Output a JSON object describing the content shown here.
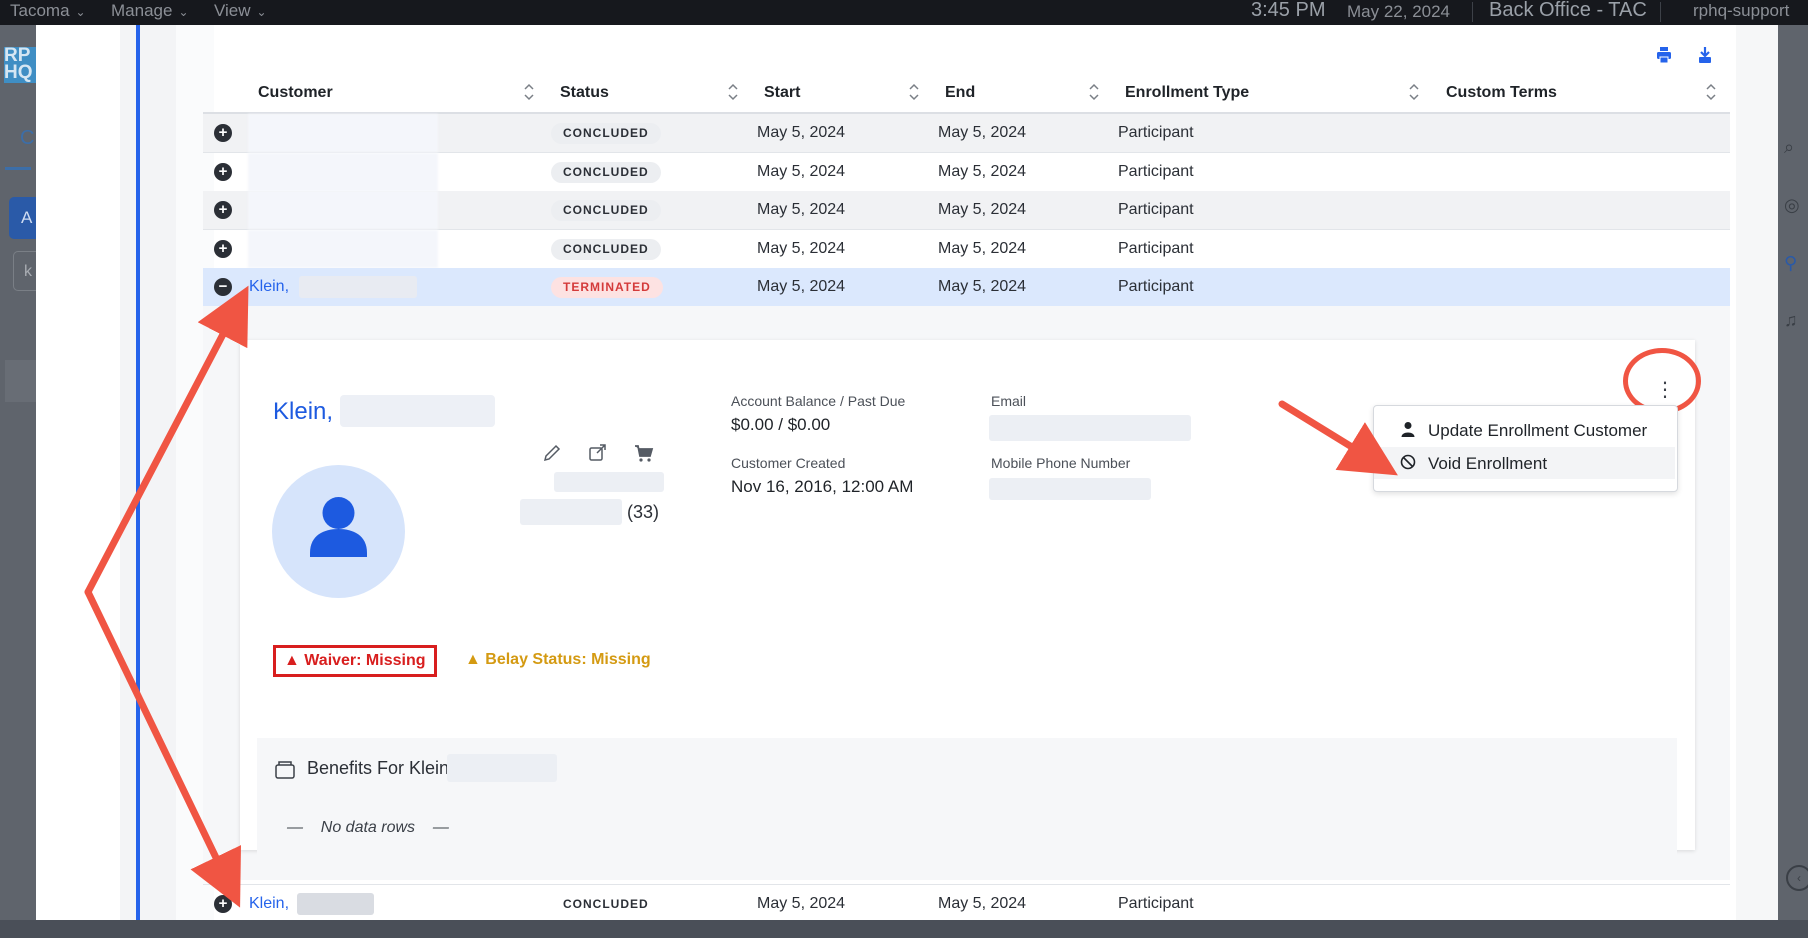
{
  "topbar": {
    "menus": [
      "Tacoma",
      "Manage",
      "View"
    ],
    "time": "3:45 PM",
    "date": "May 22, 2024",
    "context": "Back Office - TAC",
    "user": "rphq-support"
  },
  "background_page": {
    "logo": "RP\nHQ",
    "tab_letter": "C",
    "button_letter": "A",
    "input_letter": "k"
  },
  "table": {
    "columns": [
      "Customer",
      "Status",
      "Start",
      "End",
      "Enrollment Type",
      "Custom Terms"
    ],
    "rows": [
      {
        "customer": "",
        "status": "CONCLUDED",
        "start": "May 5, 2024",
        "end": "May 5, 2024",
        "type": "Participant"
      },
      {
        "customer": "",
        "status": "CONCLUDED",
        "start": "May 5, 2024",
        "end": "May 5, 2024",
        "type": "Participant"
      },
      {
        "customer": "",
        "status": "CONCLUDED",
        "start": "May 5, 2024",
        "end": "May 5, 2024",
        "type": "Participant"
      },
      {
        "customer": "",
        "status": "CONCLUDED",
        "start": "May 5, 2024",
        "end": "May 5, 2024",
        "type": "Participant"
      },
      {
        "customer": "Klein,",
        "status": "TERMINATED",
        "start": "May 5, 2024",
        "end": "May 5, 2024",
        "type": "Participant"
      },
      {
        "customer": "Klein,",
        "status": "CONCLUDED",
        "start": "May 5, 2024",
        "end": "May 5, 2024",
        "type": "Participant"
      }
    ]
  },
  "detail": {
    "name": "Klein,",
    "age": "(33)",
    "account_balance_label": "Account Balance / Past Due",
    "account_balance_value": "$0.00 / $0.00",
    "customer_created_label": "Customer Created",
    "customer_created_value": "Nov 16, 2016, 12:00 AM",
    "email_label": "Email",
    "mobile_label": "Mobile Phone Number",
    "waiver": "Waiver: Missing",
    "belay": "Belay Status: Missing",
    "benefits_title": "Benefits For Klein,",
    "benefits_empty": "No data rows"
  },
  "menu": {
    "items": [
      "Update Enrollment Customer",
      "Void Enrollment"
    ]
  },
  "colors": {
    "accent": "#2563eb",
    "annotation": "#f05543",
    "danger": "#d81e1e",
    "warning": "#d49a12"
  }
}
